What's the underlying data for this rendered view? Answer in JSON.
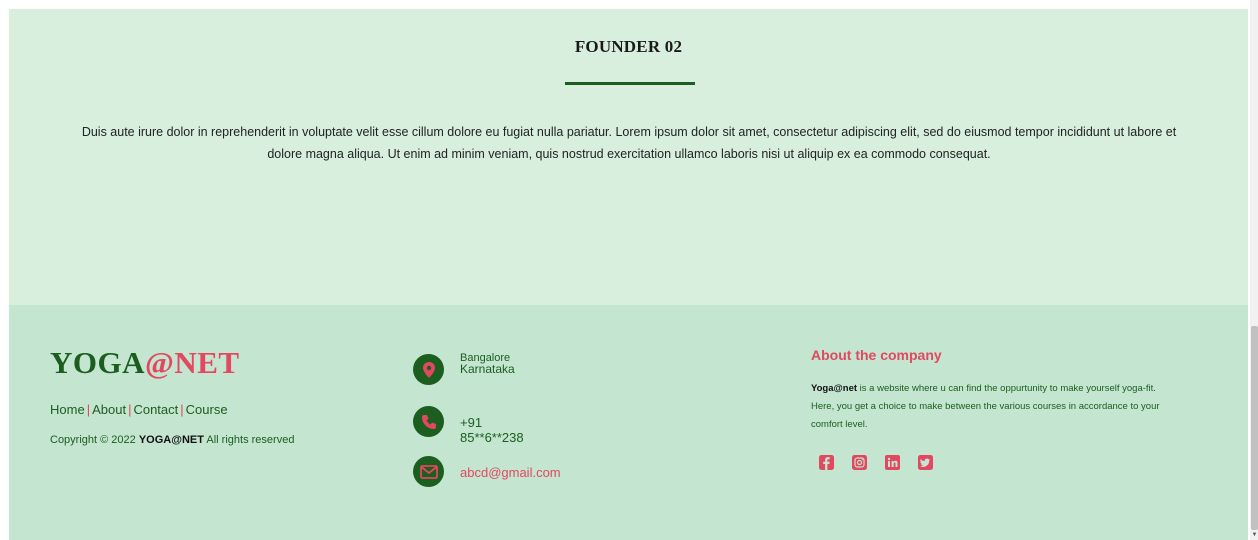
{
  "founder": {
    "title": "FOUNDER 02",
    "text": "Duis aute irure dolor in reprehenderit in voluptate velit esse cillum dolore eu fugiat nulla pariatur. Lorem ipsum dolor sit amet, consectetur adipiscing elit, sed do eiusmod tempor incididunt ut labore et dolore magna aliqua. Ut enim ad minim veniam, quis nostrud exercitation ullamco laboris nisi ut aliquip ex ea commodo consequat."
  },
  "footer": {
    "logo": {
      "part1": "YOGA",
      "part2": "@NET",
      "part3": ""
    },
    "nav": [
      "Home",
      "About",
      "Contact",
      "Course"
    ],
    "nav_separator": "|",
    "copyright_prefix": "Copyright © 2022 ",
    "copyright_brand": "YOGA@NET",
    "copyright_suffix": " All rights reserved",
    "contact": {
      "city": "Bangalore",
      "state": "Karnataka",
      "phone": "+91 85**6**238",
      "email": "abcd@gmail.com",
      "icons": [
        "location-pin-icon",
        "phone-icon",
        "mail-icon"
      ]
    },
    "about": {
      "title": "About the company",
      "brand": "Yoga@net",
      "text": " is a website where u can find the oppurtunity to make yourself yoga-fit. Here, you get a choice to make between the various courses in accordance to your comfort level."
    },
    "social_icons": [
      "facebook-icon",
      "instagram-icon",
      "linkedin-icon",
      "twitter-icon"
    ]
  },
  "colors": {
    "founder_bg": "#d8efde",
    "footer_bg": "#c4e5d0",
    "brand_green": "#1b5e1f",
    "accent_red": "#e2485f"
  }
}
